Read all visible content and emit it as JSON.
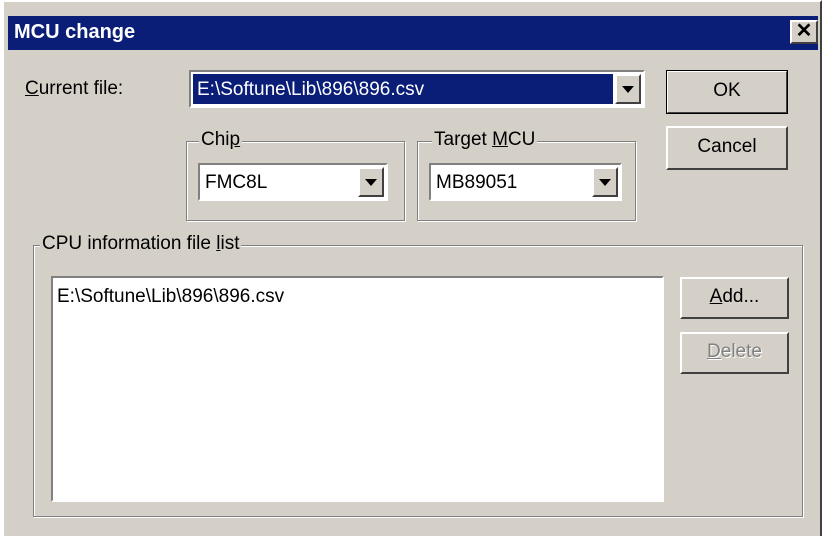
{
  "window": {
    "title": "MCU change",
    "close_glyph": "✕"
  },
  "current_file": {
    "label_accel": "C",
    "label_rest": "urrent file:",
    "value": "E:\\Softune\\Lib\\896\\896.csv"
  },
  "chip": {
    "label_pre": "Chi",
    "label_accel": "p",
    "value": "FMC8L"
  },
  "target_mcu": {
    "label_pre": "Target ",
    "label_accel": "M",
    "label_rest": "CU",
    "value": "MB89051"
  },
  "cpu_list": {
    "label_pre": "CPU information file ",
    "label_accel": "l",
    "label_rest": "ist",
    "items": [
      "E:\\Softune\\Lib\\896\\896.csv"
    ]
  },
  "buttons": {
    "ok": "OK",
    "cancel": "Cancel",
    "add_accel": "A",
    "add_rest": "dd...",
    "delete_accel": "D",
    "delete_rest": "elete"
  },
  "icons": {
    "close": "close-icon",
    "dropdown": "chevron-down-icon"
  },
  "colors": {
    "titlebar": "#0a1e78",
    "face": "#d4d0c8",
    "selection": "#0a1e78"
  }
}
